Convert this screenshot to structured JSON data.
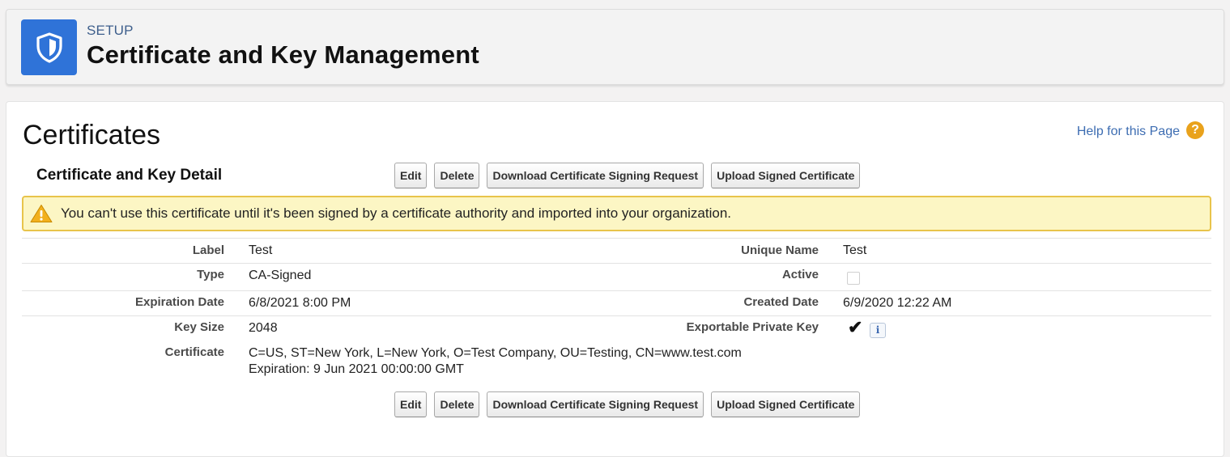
{
  "header": {
    "eyebrow": "SETUP",
    "title": "Certificate and Key Management",
    "icon": "shield-icon",
    "icon_color": "#2f73d8"
  },
  "page": {
    "heading": "Certificates",
    "help_link": "Help for this Page",
    "help_icon": "help-icon"
  },
  "section": {
    "title": "Certificate and Key Detail"
  },
  "buttons": {
    "edit": "Edit",
    "delete": "Delete",
    "download_csr": "Download Certificate Signing Request",
    "upload_signed": "Upload Signed Certificate"
  },
  "warning": {
    "icon": "warning-icon",
    "text": "You can't use this certificate until it's been signed by a certificate authority and imported into your organization."
  },
  "details": {
    "label_label": "Label",
    "label_value": "Test",
    "unique_name_label": "Unique Name",
    "unique_name_value": "Test",
    "type_label": "Type",
    "type_value": "CA-Signed",
    "active_label": "Active",
    "active_checked": false,
    "expiration_label": "Expiration Date",
    "expiration_value": "6/8/2021 8:00 PM",
    "created_label": "Created Date",
    "created_value": "6/9/2020 12:22 AM",
    "key_size_label": "Key Size",
    "key_size_value": "2048",
    "exportable_label": "Exportable Private Key",
    "exportable_checked": true,
    "exportable_mark": "✔",
    "info_glyph": "i",
    "certificate_label": "Certificate",
    "certificate_line1": "C=US, ST=New York, L=New York, O=Test Company, OU=Testing, CN=www.test.com",
    "certificate_line2": "Expiration: 9 Jun 2021 00:00:00 GMT"
  },
  "colors": {
    "warning_bg": "#fcf6c4",
    "warning_border": "#e8c44b",
    "link": "#3d6db2"
  }
}
